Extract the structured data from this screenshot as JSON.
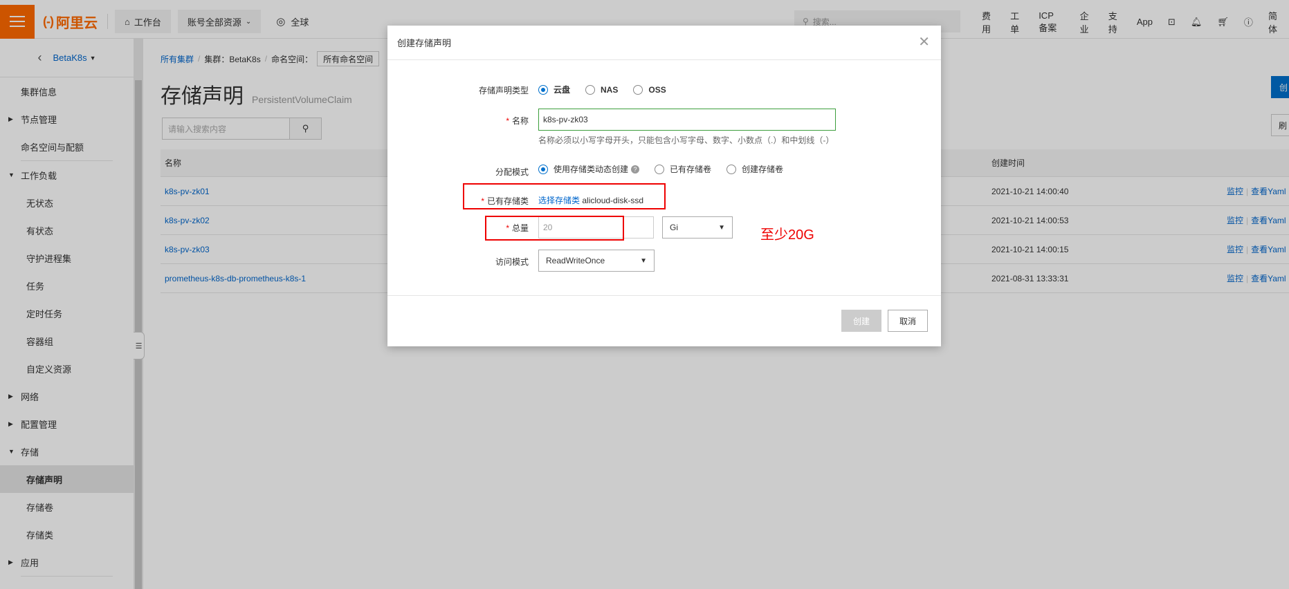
{
  "topbar": {
    "logo": "阿里云",
    "logo_mark": "(-)",
    "workbench": "工作台",
    "resources": "账号全部资源",
    "region": "全球",
    "search_placeholder": "搜索...",
    "links": [
      "费用",
      "工单",
      "ICP 备案",
      "企业",
      "支持",
      "App"
    ],
    "lang": "简体"
  },
  "sidebar": {
    "cluster": "BetaK8s",
    "items": [
      {
        "label": "集群信息",
        "type": "item"
      },
      {
        "label": "节点管理",
        "type": "group-collapsed"
      },
      {
        "label": "命名空间与配额",
        "type": "item"
      },
      {
        "label": "工作负载",
        "type": "group-expanded"
      },
      {
        "label": "无状态",
        "type": "sub"
      },
      {
        "label": "有状态",
        "type": "sub"
      },
      {
        "label": "守护进程集",
        "type": "sub"
      },
      {
        "label": "任务",
        "type": "sub"
      },
      {
        "label": "定时任务",
        "type": "sub"
      },
      {
        "label": "容器组",
        "type": "sub"
      },
      {
        "label": "自定义资源",
        "type": "sub"
      },
      {
        "label": "网络",
        "type": "group-collapsed"
      },
      {
        "label": "配置管理",
        "type": "group-collapsed"
      },
      {
        "label": "存储",
        "type": "group-expanded"
      },
      {
        "label": "存储声明",
        "type": "sub-active"
      },
      {
        "label": "存储卷",
        "type": "sub"
      },
      {
        "label": "存储类",
        "type": "sub"
      },
      {
        "label": "应用",
        "type": "group-collapsed"
      }
    ]
  },
  "main": {
    "breadcrumb": {
      "all_clusters": "所有集群",
      "cluster": "集群：BetaK8s",
      "namespace_label": "命名空间：",
      "namespace_value": "所有命名空间"
    },
    "title": "存储声明",
    "subtitle": "PersistentVolumeClaim",
    "search_placeholder": "请输入搜索内容",
    "create_btn": "创",
    "refresh_btn": "刷",
    "table": {
      "headers": {
        "name": "名称",
        "time": "创建时间"
      },
      "rows": [
        {
          "name": "k8s-pv-zk01",
          "time": "2021-10-21 14:00:40"
        },
        {
          "name": "k8s-pv-zk02",
          "time": "2021-10-21 14:00:53"
        },
        {
          "name": "k8s-pv-zk03",
          "time": "2021-10-21 14:00:15"
        },
        {
          "name": "prometheus-k8s-db-prometheus-k8s-1",
          "time": "2021-08-31 13:33:31"
        }
      ],
      "op_monitor": "监控",
      "op_yaml": "查看Yaml"
    }
  },
  "modal": {
    "title": "创建存储声明",
    "type_label": "存储声明类型",
    "type_options": [
      "云盘",
      "NAS",
      "OSS"
    ],
    "name_label": "名称",
    "name_value": "k8s-pv-zk03",
    "name_hint": "名称必须以小写字母开头，只能包含小写字母、数字、小数点（.）和中划线（-）",
    "mode_label": "分配模式",
    "mode_options": [
      "使用存储类动态创建",
      "已有存储卷",
      "创建存储卷"
    ],
    "sc_label": "已有存储类",
    "sc_link": "选择存储类",
    "sc_value": "alicloud-disk-ssd",
    "total_label": "总量",
    "total_placeholder": "20",
    "unit_value": "Gi",
    "access_label": "访问模式",
    "access_value": "ReadWriteOnce",
    "create_btn": "创建",
    "cancel_btn": "取消"
  },
  "annotation": {
    "note": "至少20G",
    "color": "#e00000"
  }
}
